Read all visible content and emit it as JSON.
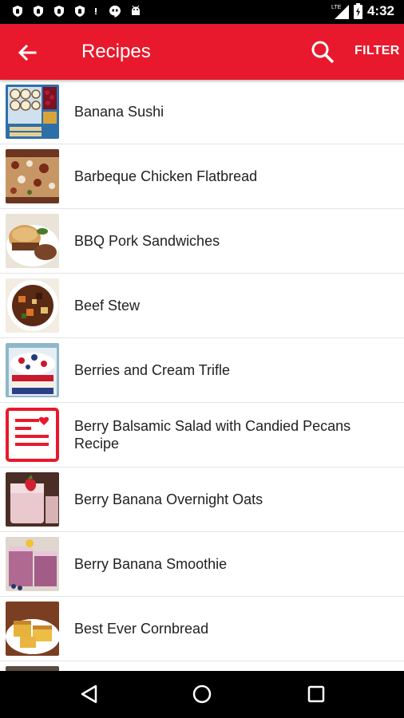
{
  "status_bar": {
    "time": "4:32",
    "network": "LTE",
    "icons": [
      "shield-icon",
      "shield-icon",
      "shield-icon",
      "shield-icon",
      "alert-icon",
      "hangouts-icon",
      "android-icon"
    ]
  },
  "app_bar": {
    "back_icon": "arrow-left-icon",
    "title": "Recipes",
    "search_icon": "search-icon",
    "filter_label": "FILTER",
    "color": "#e8192c"
  },
  "recipes": [
    {
      "name": "Banana Sushi"
    },
    {
      "name": "Barbeque Chicken Flatbread"
    },
    {
      "name": "BBQ Pork Sandwiches"
    },
    {
      "name": "Beef Stew"
    },
    {
      "name": "Berries and Cream Trifle"
    },
    {
      "name": "Berry Balsamic Salad with Candied Pecans Recipe"
    },
    {
      "name": "Berry Banana Overnight Oats"
    },
    {
      "name": "Berry Banana Smoothie"
    },
    {
      "name": "Best Ever Cornbread"
    }
  ],
  "nav_bar": {
    "back": "triangle-back-icon",
    "home": "circle-home-icon",
    "recents": "square-recents-icon"
  }
}
